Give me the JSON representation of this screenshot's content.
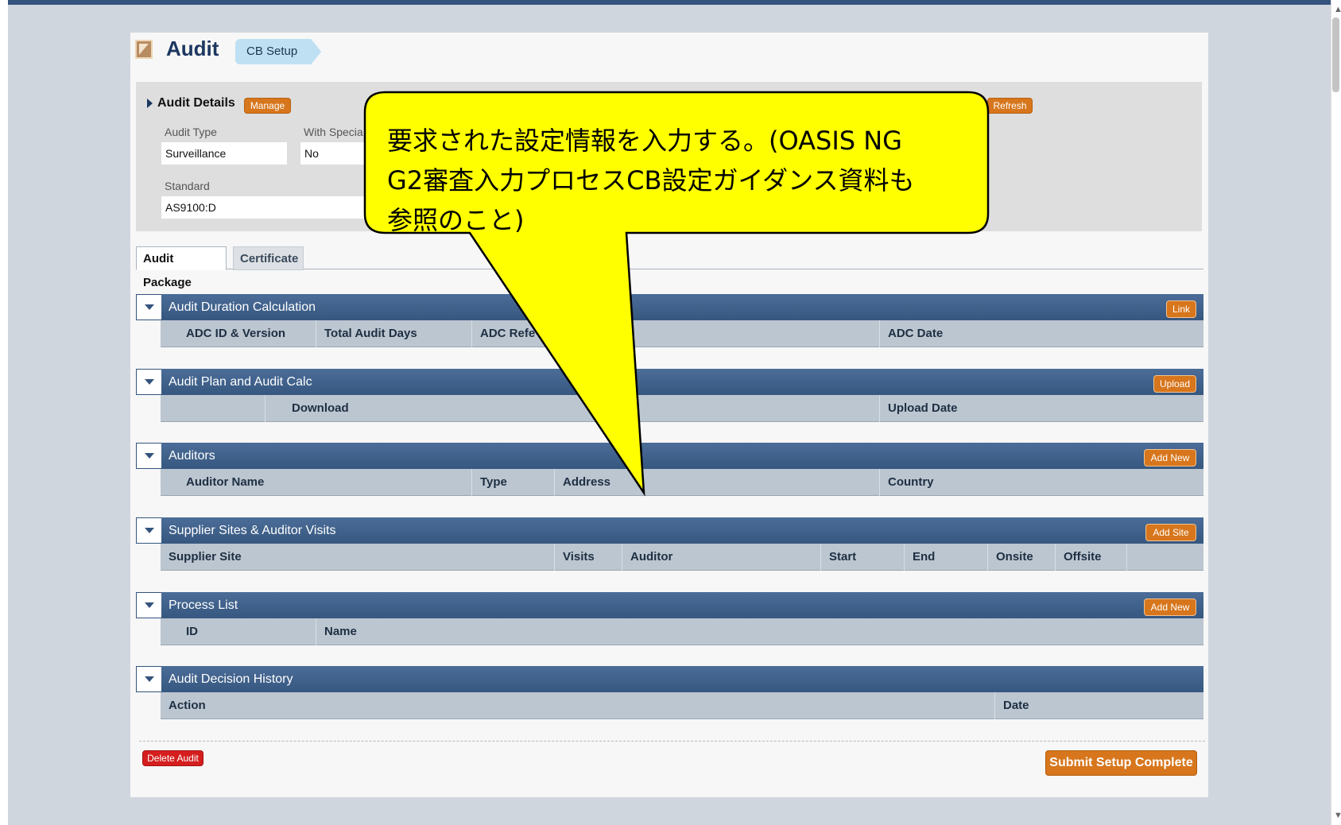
{
  "header": {
    "title": "Audit",
    "breadcrumb": "CB Setup"
  },
  "details": {
    "title": "Audit Details",
    "manage_label": "Manage",
    "refresh_label": "Refresh",
    "audit_type_label": "Audit Type",
    "audit_type_value": "Surveillance",
    "with_special_label": "With Specia",
    "with_special_value": "No",
    "standard_label": "Standard",
    "standard_value": "AS9100:D"
  },
  "tabs": [
    {
      "label": "Audit Package"
    },
    {
      "label": "Certificate"
    }
  ],
  "sections": {
    "adc": {
      "title": "Audit Duration Calculation",
      "button": "Link",
      "cols": [
        "ADC ID & Version",
        "Total Audit Days",
        "ADC Refe",
        "ADC Date"
      ]
    },
    "plan": {
      "title": "Audit Plan and Audit Calc",
      "button": "Upload",
      "cols": [
        "Download",
        "Upload Date"
      ]
    },
    "auditors": {
      "title": "Auditors",
      "button": "Add New",
      "cols": [
        "Auditor Name",
        "Type",
        "Address",
        "Country"
      ]
    },
    "sites": {
      "title": "Supplier Sites & Auditor Visits",
      "button": "Add Site",
      "cols": [
        "Supplier Site",
        "Visits",
        "Auditor",
        "Start",
        "End",
        "Onsite",
        "Offsite"
      ]
    },
    "process": {
      "title": "Process List",
      "button": "Add New",
      "cols": [
        "ID",
        "Name"
      ]
    },
    "history": {
      "title": "Audit Decision History",
      "cols": [
        "Action",
        "Date"
      ]
    }
  },
  "footer": {
    "delete_label": "Delete Audit",
    "submit_label": "Submit Setup Complete"
  },
  "callout": {
    "line1": "要求された設定情報を入力する。(OASIS NG",
    "line2": "G2審査入力プロセスCB設定ガイダンス資料も",
    "line3": "参照のこと)"
  },
  "colors": {
    "header_blue": "#34547e",
    "accent_orange": "#d7761c",
    "delete_red": "#d51e1e",
    "callout_yellow": "#ffff00"
  }
}
